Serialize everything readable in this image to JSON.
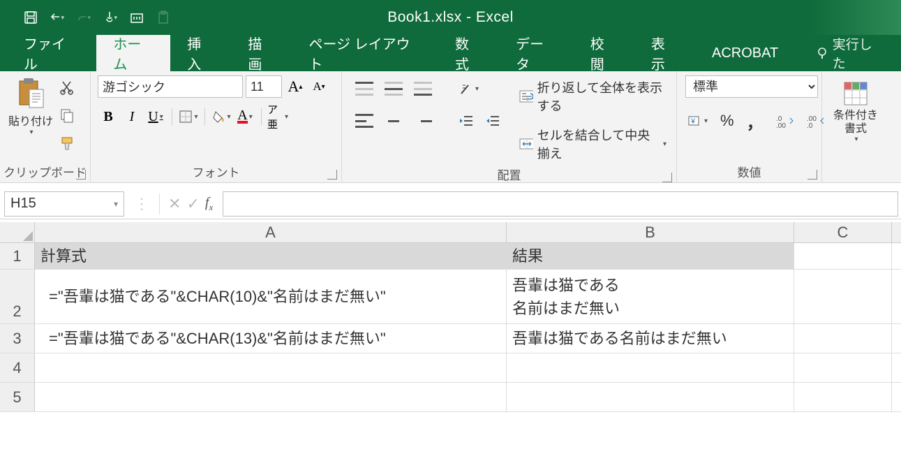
{
  "title": {
    "book": "Book1.xlsx",
    "dash": "  -  ",
    "app": "Excel"
  },
  "tabs": {
    "file": "ファイル",
    "home": "ホーム",
    "insert": "挿入",
    "draw": "描画",
    "layout": "ページ レイアウト",
    "formulas": "数式",
    "data": "データ",
    "review": "校閲",
    "view": "表示",
    "acrobat": "ACROBAT",
    "tell": "実行した"
  },
  "ribbon": {
    "clipboard": {
      "label": "クリップボード",
      "paste": "貼り付け"
    },
    "font": {
      "label": "フォント",
      "name": "游ゴシック",
      "size": "11",
      "bold": "B",
      "italic": "I",
      "underline": "U",
      "ruby": "ア亜"
    },
    "align": {
      "label": "配置",
      "wrap": "折り返して全体を表示する",
      "merge": "セルを結合して中央揃え"
    },
    "number": {
      "label": "数値",
      "format": "標準",
      "percent": "%",
      "comma": "，",
      "inc": ".0→.00",
      "dec": ".00→.0"
    },
    "styles": {
      "cond": "条件付き\n書式"
    }
  },
  "namebox": "H15",
  "columns": {
    "A": "A",
    "B": "B",
    "C": "C"
  },
  "rows": {
    "r1": {
      "A": "計算式",
      "B": "結果"
    },
    "r2": {
      "A": "=\"吾輩は猫である\"&CHAR(10)&\"名前はまだ無い\"",
      "B": "吾輩は猫である\n名前はまだ無い"
    },
    "r3": {
      "A": "=\"吾輩は猫である\"&CHAR(13)&\"名前はまだ無い\"",
      "B": "吾輩は猫である名前はまだ無い"
    }
  }
}
